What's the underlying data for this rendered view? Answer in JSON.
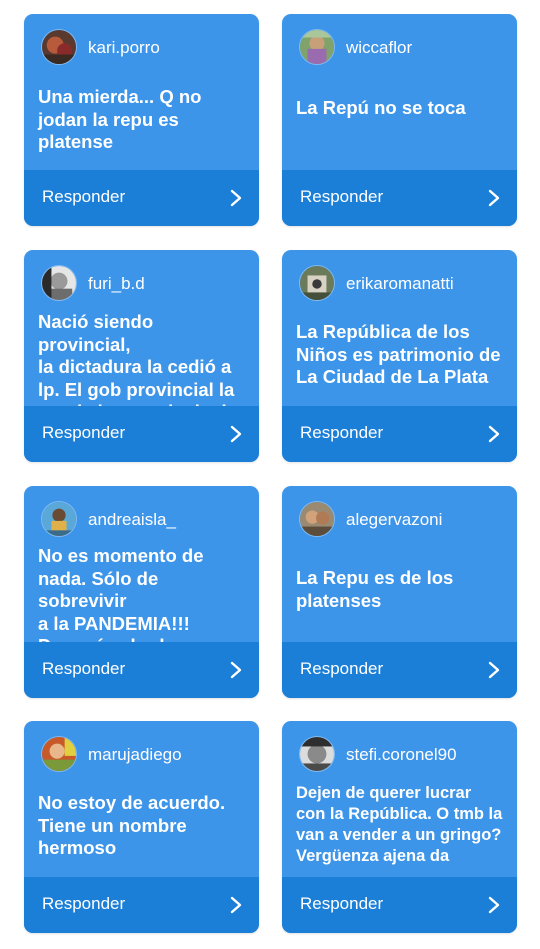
{
  "colors": {
    "card_background": "#3d95ea",
    "reply_bar_background": "#1b7fd8",
    "text": "#ffffff"
  },
  "cards": [
    {
      "username": "kari.porro",
      "comment": "Una mierda... Q no\njodan la repu es\nplatense",
      "reply_label": "Responder",
      "avatar_icon": "avatar-photo-icon",
      "chevron_icon": "chevron-right-icon"
    },
    {
      "username": "wiccaflor",
      "comment": "La Repú no se toca",
      "reply_label": "Responder",
      "avatar_icon": "avatar-photo-icon",
      "chevron_icon": "chevron-right-icon"
    },
    {
      "username": "furi_b.d",
      "comment": "Nació siendo provincial,\nla dictadura la cedió a\nlp. El gob provincial la\npuede hacer + inclusiv",
      "reply_label": "Responder",
      "avatar_icon": "avatar-photo-icon",
      "chevron_icon": "chevron-right-icon"
    },
    {
      "username": "erikaromanatti",
      "comment": "La República de los\nNiños es patrimonio de\nLa Ciudad de La Plata",
      "reply_label": "Responder",
      "avatar_icon": "avatar-photo-icon",
      "chevron_icon": "chevron-right-icon"
    },
    {
      "username": "andreaisla_",
      "comment": "No es momento de\nnada. Sólo de sobrevivir\na la PANDEMIA!!!\nDespués charlamos",
      "reply_label": "Responder",
      "avatar_icon": "avatar-photo-icon",
      "chevron_icon": "chevron-right-icon"
    },
    {
      "username": "alegervazoni",
      "comment": "La Repu es de los\nplatenses",
      "reply_label": "Responder",
      "avatar_icon": "avatar-photo-icon",
      "chevron_icon": "chevron-right-icon"
    },
    {
      "username": "marujadiego",
      "comment": "No estoy de acuerdo.\nTiene un nombre\nhermoso",
      "reply_label": "Responder",
      "avatar_icon": "avatar-photo-icon",
      "chevron_icon": "chevron-right-icon"
    },
    {
      "username": "stefi.coronel90",
      "comment": "Dejen de querer lucrar\ncon la República. O tmb la\nvan a vender a un gringo?\nVergüenza ajena da",
      "reply_label": "Responder",
      "avatar_icon": "avatar-photo-icon",
      "chevron_icon": "chevron-right-icon"
    }
  ]
}
